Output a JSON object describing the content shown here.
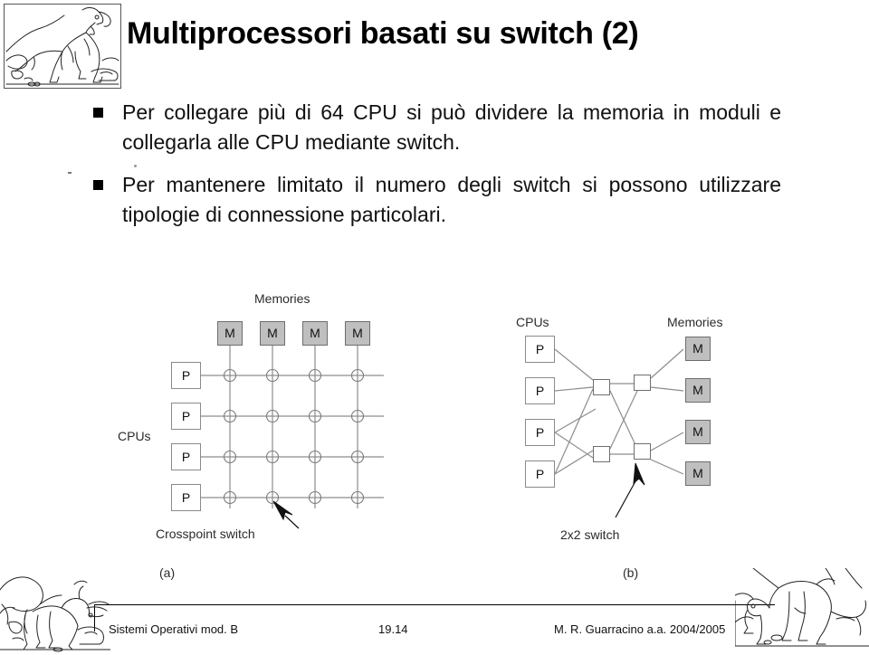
{
  "slide": {
    "title": "Multiprocessori basati su switch (2)",
    "bullets": [
      "Per collegare più di 64 CPU si può dividere la memoria in moduli e collegarla alle CPU mediante switch.",
      "Per mantenere limitato il numero degli switch si possono utilizzare tipologie di connessione particolari."
    ]
  },
  "figure": {
    "crossbar": {
      "caption": "(a)",
      "memories_label": "Memories",
      "cpus_label": "CPUs",
      "switch_label": "Crosspoint switch",
      "memory_nodes": [
        "M",
        "M",
        "M",
        "M"
      ],
      "cpu_nodes": [
        "P",
        "P",
        "P",
        "P"
      ]
    },
    "omega": {
      "caption": "(b)",
      "cpus_label": "CPUs",
      "memories_label": "Memories",
      "switch_label": "2x2 switch",
      "cpu_nodes": [
        "P",
        "P",
        "P",
        "P"
      ],
      "memory_nodes": [
        "M",
        "M",
        "M",
        "M"
      ]
    }
  },
  "footer": {
    "course": "Sistemi Operativi mod. B",
    "page": "19.14",
    "author": "M. R. Guarracino a.a. 2004/2005"
  },
  "icons": {
    "header_art": "dinosaur-tyrannosaurus-art",
    "corner_art_left": "dinosaur-triceratops-art",
    "corner_art_right": "dinosaur-sauropod-art",
    "bullet_marker": "square-bullet-icon",
    "pointer": "arrow-pointer-icon"
  },
  "colors": {
    "memory_fill": "#bfbfbf",
    "node_border": "#6e6e6e",
    "wire": "#888888",
    "text": "#111111"
  }
}
